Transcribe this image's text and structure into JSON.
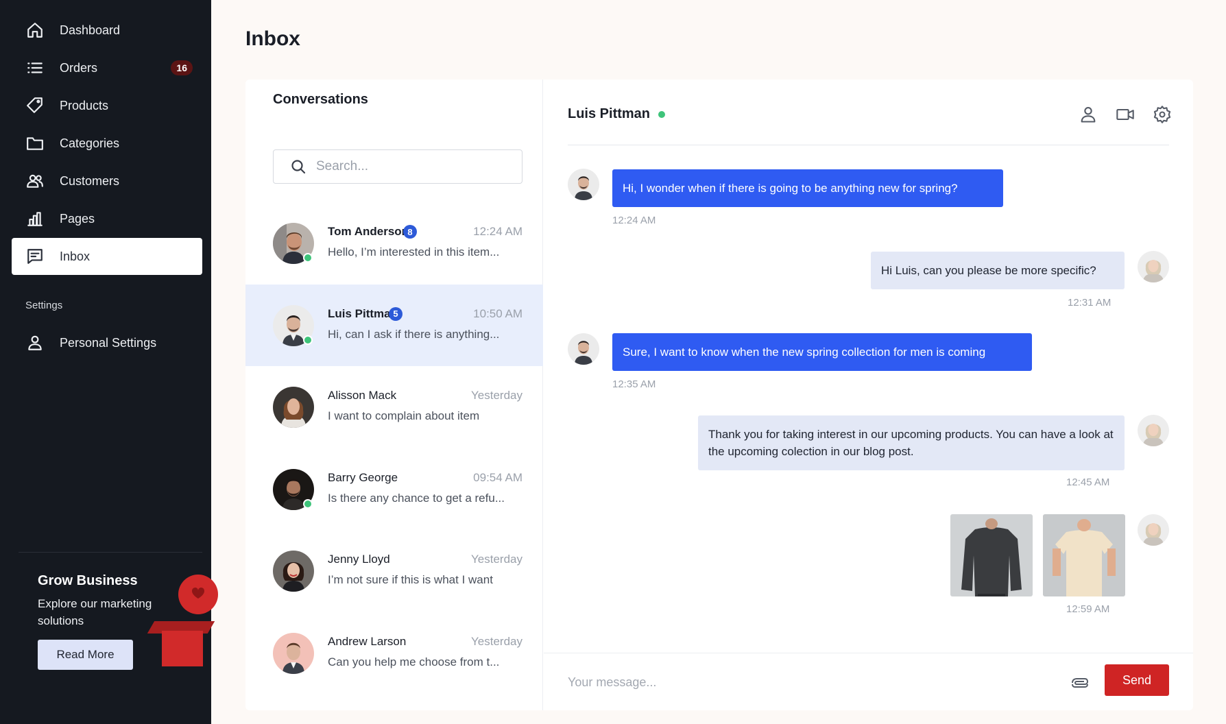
{
  "sidebar": {
    "items": [
      {
        "label": "Dashboard",
        "icon": "home-icon"
      },
      {
        "label": "Orders",
        "icon": "list-icon",
        "badge": "16"
      },
      {
        "label": "Products",
        "icon": "tag-icon"
      },
      {
        "label": "Categories",
        "icon": "folder-icon"
      },
      {
        "label": "Customers",
        "icon": "users-icon"
      },
      {
        "label": "Pages",
        "icon": "chart-icon"
      },
      {
        "label": "Inbox",
        "icon": "inbox-icon",
        "active": true
      }
    ],
    "settings_heading": "Settings",
    "settings_items": [
      {
        "label": "Personal Settings",
        "icon": "user-icon"
      }
    ],
    "promo": {
      "title": "Grow Business",
      "text": "Explore our marketing solutions",
      "button": "Read More"
    }
  },
  "page": {
    "title": "Inbox"
  },
  "conversations": {
    "title": "Conversations",
    "search_placeholder": "Search...",
    "items": [
      {
        "name": "Tom Anderson",
        "unread": "8",
        "time": "12:24 AM",
        "preview": "Hello, I’m interested in this item...",
        "online": true
      },
      {
        "name": "Luis Pittman",
        "unread": "5",
        "time": "10:50 AM",
        "preview": "Hi, can I ask if there is anything...",
        "online": true,
        "selected": true
      },
      {
        "name": "Alisson Mack",
        "time": "Yesterday",
        "preview": "I want to complain about item",
        "online": false
      },
      {
        "name": "Barry George",
        "time": "09:54 AM",
        "preview": "Is there any chance to get a refu...",
        "online": true
      },
      {
        "name": "Jenny Lloyd",
        "time": "Yesterday",
        "preview": "I’m not sure if this is what I want",
        "online": false
      },
      {
        "name": "Andrew Larson",
        "time": "Yesterday",
        "preview": "Can you help me choose from t...",
        "online": false
      }
    ]
  },
  "chat": {
    "contact_name": "Luis Pittman",
    "messages": [
      {
        "direction": "in",
        "text": "Hi, I wonder when if there is going to be anything new for spring?",
        "time": "12:24 AM"
      },
      {
        "direction": "out",
        "text": "Hi Luis, can you please be more specific?",
        "time": "12:31 AM"
      },
      {
        "direction": "in",
        "text": "Sure, I want to know when the new spring collection for men is coming",
        "time": "12:35 AM"
      },
      {
        "direction": "out",
        "text": "Thank you for taking interest in our upcoming products. You can have a look at the upcoming colection in our blog post.",
        "time": "12:45 AM"
      },
      {
        "direction": "out",
        "attachments": [
          "dark-longsleeve-shirt",
          "cream-tshirt"
        ],
        "time": "12:59 AM"
      }
    ],
    "composer": {
      "placeholder": "Your message...",
      "send_label": "Send"
    }
  },
  "colors": {
    "sidebar_bg": "#151920",
    "accent_blue": "#2f5bf2",
    "send_red": "#cf2424",
    "online_green": "#3ec47a",
    "selected_row": "#e8eefc"
  }
}
